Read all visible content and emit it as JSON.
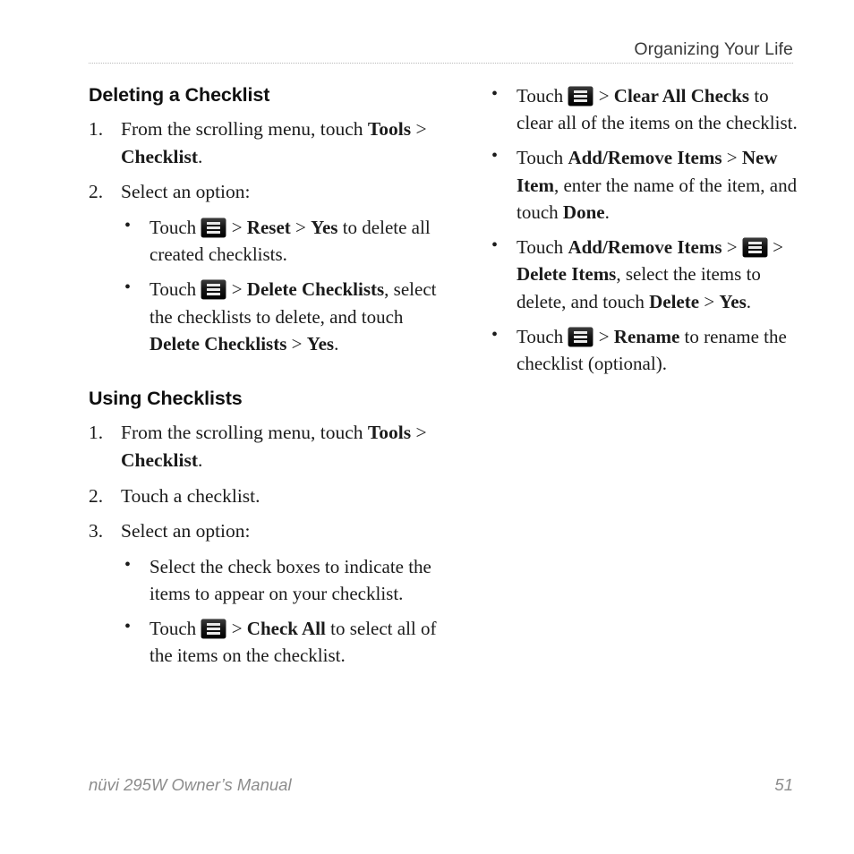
{
  "header": {
    "title": "Organizing Your Life"
  },
  "icons": {
    "menu": "menu-icon"
  },
  "left_column": {
    "sections": [
      {
        "heading": "Deleting a Checklist",
        "steps": [
          {
            "number": "1.",
            "text_parts": [
              {
                "t": "From the scrolling menu, touch ",
                "b": false
              },
              {
                "t": "Tools",
                "b": true
              },
              {
                "t": " > ",
                "b": false
              },
              {
                "t": "Checklist",
                "b": true
              },
              {
                "t": ".",
                "b": false
              }
            ]
          },
          {
            "number": "2.",
            "text_parts": [
              {
                "t": "Select an option:",
                "b": false
              }
            ],
            "bullets": [
              {
                "marker": "•",
                "parts": [
                  {
                    "t": "Touch ",
                    "b": false
                  },
                  {
                    "icon": "menu"
                  },
                  {
                    "t": " > ",
                    "b": false
                  },
                  {
                    "t": "Reset",
                    "b": true
                  },
                  {
                    "t": " > ",
                    "b": false
                  },
                  {
                    "t": "Yes",
                    "b": true
                  },
                  {
                    "t": " to delete all created checklists.",
                    "b": false
                  }
                ]
              },
              {
                "marker": "•",
                "parts": [
                  {
                    "t": "Touch ",
                    "b": false
                  },
                  {
                    "icon": "menu"
                  },
                  {
                    "t": " > ",
                    "b": false
                  },
                  {
                    "t": "Delete Checklists",
                    "b": true
                  },
                  {
                    "t": ", select the checklists to delete, and touch ",
                    "b": false
                  },
                  {
                    "t": "Delete Checklists",
                    "b": true
                  },
                  {
                    "t": " > ",
                    "b": false
                  },
                  {
                    "t": "Yes",
                    "b": true
                  },
                  {
                    "t": ".",
                    "b": false
                  }
                ]
              }
            ]
          }
        ]
      },
      {
        "heading": "Using Checklists",
        "steps": [
          {
            "number": "1.",
            "text_parts": [
              {
                "t": "From the scrolling menu, touch ",
                "b": false
              },
              {
                "t": "Tools",
                "b": true
              },
              {
                "t": " > ",
                "b": false
              },
              {
                "t": "Checklist",
                "b": true
              },
              {
                "t": ".",
                "b": false
              }
            ]
          },
          {
            "number": "2.",
            "text_parts": [
              {
                "t": "Touch a checklist.",
                "b": false
              }
            ]
          },
          {
            "number": "3.",
            "text_parts": [
              {
                "t": "Select an option:",
                "b": false
              }
            ],
            "bullets": [
              {
                "marker": "•",
                "parts": [
                  {
                    "t": "Select the check boxes to indicate the items to appear on your checklist.",
                    "b": false
                  }
                ]
              },
              {
                "marker": "•",
                "parts": [
                  {
                    "t": "Touch ",
                    "b": false
                  },
                  {
                    "icon": "menu"
                  },
                  {
                    "t": " > ",
                    "b": false
                  },
                  {
                    "t": "Check All",
                    "b": true
                  },
                  {
                    "t": " to select all of the items on the checklist.",
                    "b": false
                  }
                ]
              }
            ]
          }
        ]
      }
    ]
  },
  "right_column": {
    "bullets": [
      {
        "marker": "•",
        "parts": [
          {
            "t": "Touch ",
            "b": false
          },
          {
            "icon": "menu"
          },
          {
            "t": " > ",
            "b": false
          },
          {
            "t": "Clear All Checks",
            "b": true
          },
          {
            "t": " to clear all of the items on the checklist.",
            "b": false
          }
        ]
      },
      {
        "marker": "•",
        "parts": [
          {
            "t": "Touch ",
            "b": false
          },
          {
            "t": "Add/Remove Items",
            "b": true
          },
          {
            "t": " > ",
            "b": false
          },
          {
            "t": "New Item",
            "b": true
          },
          {
            "t": ", enter the name of the item, and touch ",
            "b": false
          },
          {
            "t": "Done",
            "b": true
          },
          {
            "t": ".",
            "b": false
          }
        ]
      },
      {
        "marker": "•",
        "parts": [
          {
            "t": "Touch ",
            "b": false
          },
          {
            "t": "Add/Remove Items",
            "b": true
          },
          {
            "t": " > ",
            "b": false
          },
          {
            "icon": "menu"
          },
          {
            "t": " > ",
            "b": false
          },
          {
            "t": "Delete Items",
            "b": true
          },
          {
            "t": ", select the items to delete, and touch ",
            "b": false
          },
          {
            "t": "Delete",
            "b": true
          },
          {
            "t": " > ",
            "b": false
          },
          {
            "t": "Yes",
            "b": true
          },
          {
            "t": ".",
            "b": false
          }
        ]
      },
      {
        "marker": "•",
        "parts": [
          {
            "t": "Touch ",
            "b": false
          },
          {
            "icon": "menu"
          },
          {
            "t": " > ",
            "b": false
          },
          {
            "t": "Rename",
            "b": true
          },
          {
            "t": " to rename the checklist (optional).",
            "b": false
          }
        ]
      }
    ]
  },
  "footer": {
    "manual_title": "nüvi 295W Owner’s Manual",
    "page_number": "51"
  },
  "colors": {
    "text": "#1b1b1b",
    "header_text": "#3a3a3a",
    "footer_text": "#8c8c8c",
    "rule": "#b9b9b9",
    "icon_bg": "#1d1d1d",
    "icon_bars": "#e9e9e9"
  }
}
